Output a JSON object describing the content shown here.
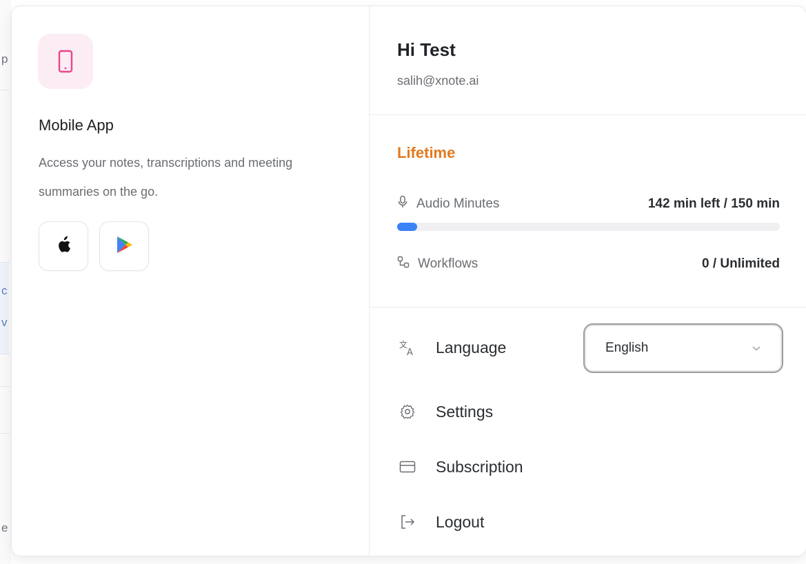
{
  "background": {
    "glyphs": [
      "p",
      "c",
      "v",
      "e"
    ]
  },
  "mobile_app": {
    "title": "Mobile App",
    "description": "Access your notes, transcriptions and meeting summaries on the go.",
    "icon": "phone-icon",
    "stores": [
      {
        "name": "apple-app-store",
        "icon": "apple-icon"
      },
      {
        "name": "google-play-store",
        "icon": "google-play-icon"
      }
    ]
  },
  "user": {
    "greeting": "Hi Test",
    "email": "salih@xnote.ai"
  },
  "plan": {
    "name": "Lifetime",
    "color": "#e07a1f"
  },
  "usage": {
    "audio": {
      "label": "Audio Minutes",
      "value": "142 min left / 150 min",
      "used_fraction": 0.053,
      "icon": "microphone-icon"
    },
    "workflows": {
      "label": "Workflows",
      "value": "0 / Unlimited",
      "icon": "workflow-icon"
    }
  },
  "menu": {
    "language": {
      "label": "Language",
      "selected": "English",
      "icon": "translate-icon"
    },
    "settings": {
      "label": "Settings",
      "icon": "gear-icon"
    },
    "subscription": {
      "label": "Subscription",
      "icon": "credit-card-icon"
    },
    "logout": {
      "label": "Logout",
      "icon": "logout-icon"
    }
  },
  "colors": {
    "accent": "#3b82f6",
    "phone_icon": "#e8458b"
  }
}
